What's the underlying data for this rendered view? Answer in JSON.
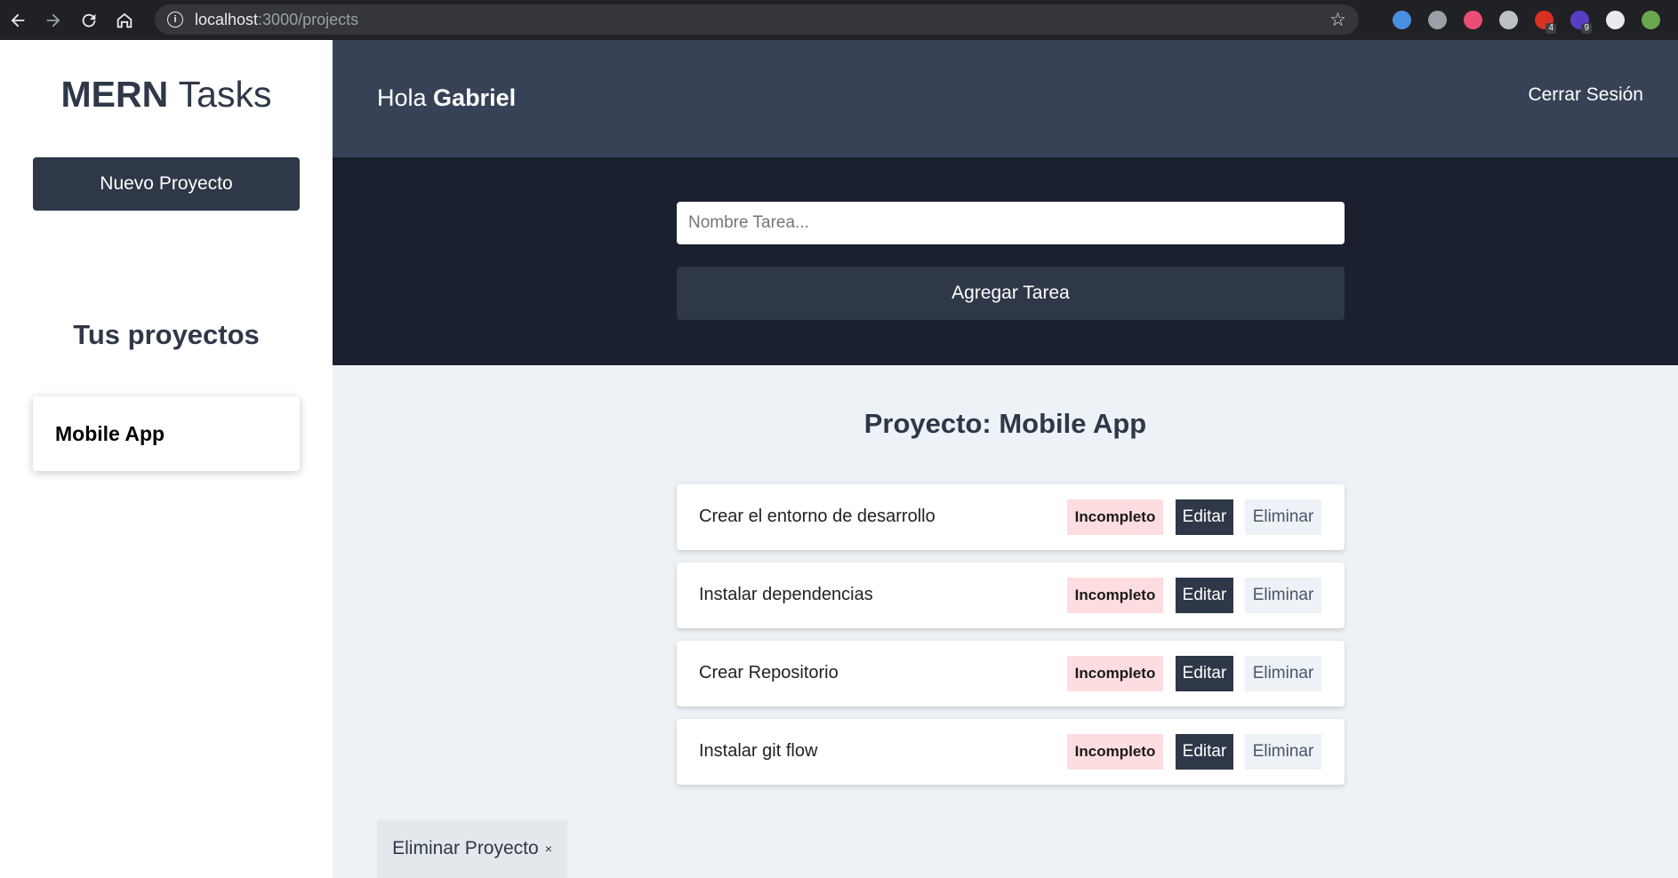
{
  "browser": {
    "url_host": "localhost",
    "url_path": ":3000/projects",
    "extensions": [
      {
        "icon": "profile-ext-icon",
        "color": "#4a90e2"
      },
      {
        "icon": "c-ext-icon",
        "color": "#9aa0a6"
      },
      {
        "icon": "wave-ext-icon",
        "color": "#e94e77"
      },
      {
        "icon": "v-ext-icon",
        "color": "#bdc1c6"
      },
      {
        "icon": "calendar-ext-icon",
        "color": "#d93025",
        "badge": "4"
      },
      {
        "icon": "hex-ext-icon",
        "color": "#5b3cc4",
        "badge": "9"
      },
      {
        "icon": "puzzle-ext-icon",
        "color": "#e8eaed"
      },
      {
        "icon": "avatar-icon",
        "color": "#6aa84f"
      }
    ]
  },
  "sidebar": {
    "brand_bold": "MERN",
    "brand_light": "Tasks",
    "new_project_label": "Nuevo Proyecto",
    "projects_heading": "Tus proyectos",
    "projects": [
      "Mobile App"
    ]
  },
  "header": {
    "greeting_prefix": "Hola",
    "user_name": "Gabriel",
    "logout_label": "Cerrar Sesión"
  },
  "task_form": {
    "placeholder": "Nombre Tarea...",
    "value": "",
    "submit_label": "Agregar Tarea"
  },
  "project": {
    "title": "Proyecto: Mobile App",
    "delete_label": "Eliminar Proyecto",
    "delete_symbol": "×"
  },
  "tasks": [
    {
      "name": "Crear el entorno de desarrollo",
      "status": "Incompleto",
      "edit": "Editar",
      "delete": "Eliminar"
    },
    {
      "name": "Instalar dependencias",
      "status": "Incompleto",
      "edit": "Editar",
      "delete": "Eliminar"
    },
    {
      "name": "Crear Repositorio",
      "status": "Incompleto",
      "edit": "Editar",
      "delete": "Eliminar"
    },
    {
      "name": "Instalar git flow",
      "status": "Incompleto",
      "edit": "Editar",
      "delete": "Eliminar"
    }
  ],
  "colors": {
    "primary": "#2f3848",
    "header": "#374256",
    "form_band": "#1a202d",
    "content_bg": "#edf2f6",
    "incomplete_badge": "#fddde0"
  }
}
